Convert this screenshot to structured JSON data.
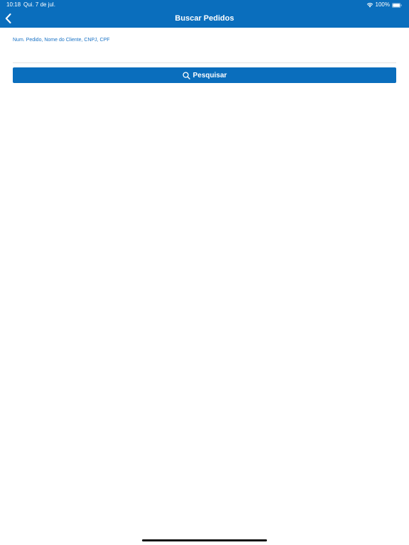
{
  "status_bar": {
    "time": "10:18",
    "date": "Qui. 7 de jul.",
    "battery": "100%",
    "wifi_icon": "wifi-icon",
    "battery_icon": "battery-icon"
  },
  "nav": {
    "title": "Buscar Pedidos",
    "back_icon": "chevron-left-icon"
  },
  "search": {
    "label": "Num. Pedido, Nome do Cliente, CNPJ, CPF",
    "value": "",
    "placeholder": "",
    "button_label": "Pesquisar",
    "button_icon": "search-icon"
  },
  "colors": {
    "primary": "#0a6ebd",
    "label": "#1a73c6",
    "background": "#ffffff"
  }
}
